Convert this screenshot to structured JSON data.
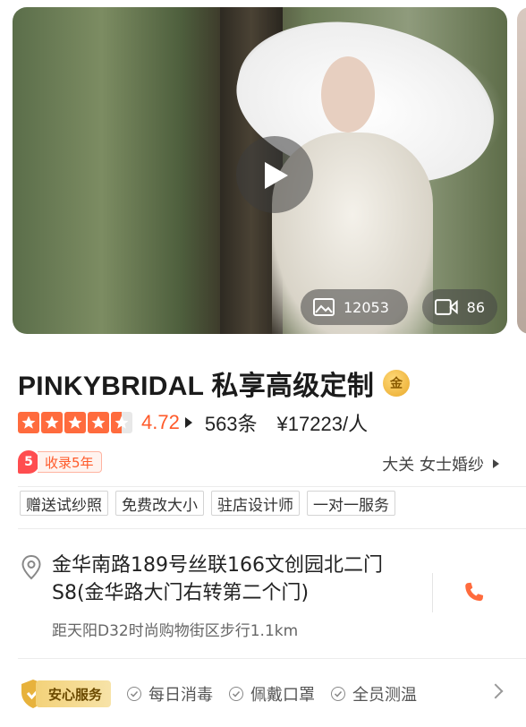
{
  "media": {
    "photo_count": "12053",
    "video_count": "86"
  },
  "shop": {
    "name": "PINKYBRIDAL 私享高级定制",
    "badge": "金",
    "rating": "4.72",
    "stars": 4.5,
    "reviews": "563条",
    "price": "¥17223/人",
    "collected_num": "5",
    "collected_label": "收录5年",
    "region": "大关 女士婚纱"
  },
  "tags": [
    "赠送试纱照",
    "免费改大小",
    "驻店设计师",
    "一对一服务"
  ],
  "address": {
    "text": "金华南路189号丝联166文创园北二门S8(金华路大门右转第二个门)",
    "distance": "距天阳D32时尚购物街区步行1.1km"
  },
  "service": {
    "label": "安心服务",
    "items": [
      "每日消毒",
      "佩戴口罩",
      "全员测温"
    ]
  },
  "colors": {
    "accent": "#ff5a2a",
    "star": "#ff6b3d",
    "gold": "#f3d27a"
  }
}
